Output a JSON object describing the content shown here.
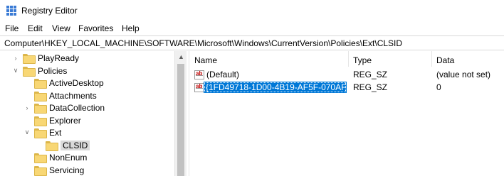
{
  "window": {
    "title": "Registry Editor"
  },
  "menu": [
    "File",
    "Edit",
    "View",
    "Favorites",
    "Help"
  ],
  "address": "Computer\\HKEY_LOCAL_MACHINE\\SOFTWARE\\Microsoft\\Windows\\CurrentVersion\\Policies\\Ext\\CLSID",
  "tree": [
    {
      "label": "PlayReady",
      "expander": "collapsed",
      "level": 2
    },
    {
      "label": "Policies",
      "expander": "expanded",
      "level": 1
    },
    {
      "label": "ActiveDesktop",
      "expander": "none",
      "level": 3
    },
    {
      "label": "Attachments",
      "expander": "none",
      "level": 3
    },
    {
      "label": "DataCollection",
      "expander": "collapsed",
      "level": 3
    },
    {
      "label": "Explorer",
      "expander": "none",
      "level": 3
    },
    {
      "label": "Ext",
      "expander": "expanded",
      "level": 3
    },
    {
      "label": "CLSID",
      "expander": "none",
      "level": 4,
      "selected": true
    },
    {
      "label": "NonEnum",
      "expander": "none",
      "level": 3
    },
    {
      "label": "Servicing",
      "expander": "none",
      "level": 3
    }
  ],
  "columns": {
    "name": "Name",
    "type": "Type",
    "data": "Data"
  },
  "values": [
    {
      "icon": "string-value-icon",
      "name": "(Default)",
      "type": "REG_SZ",
      "data": "(value not set)"
    },
    {
      "icon": "string-value-icon",
      "name": "{1FD49718-1D00-4B19-AF5F-070AF6...",
      "type": "REG_SZ",
      "data": "0",
      "selected": true
    }
  ],
  "colors": {
    "selection": "#0078d7",
    "tree_selection": "#d9d9d9",
    "folder": "#f8d775"
  }
}
